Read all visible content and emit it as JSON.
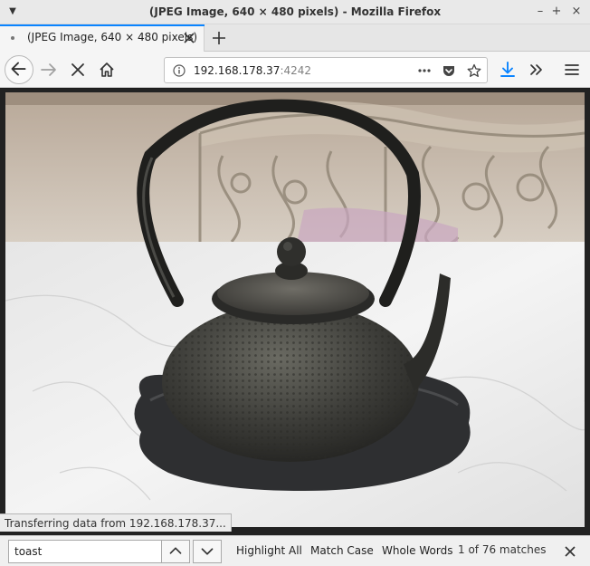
{
  "window": {
    "title": "(JPEG Image, 640 × 480 pixels) - Mozilla Firefox",
    "menu_icon": "chevron-down-icon",
    "minimize_label": "–",
    "maximize_label": "+",
    "close_label": "×"
  },
  "tab": {
    "title": "(JPEG Image, 640 × 480 pixels)",
    "accent_color": "#0a84ff"
  },
  "url": {
    "host": "192.168.178.37",
    "port": ":4242"
  },
  "status": {
    "text": "Transferring data from 192.168.178.37..."
  },
  "findbar": {
    "query": "toast",
    "highlight_all": "Highlight All",
    "match_case": "Match Case",
    "whole_words": "Whole Words",
    "matches": "1 of 76 matches"
  },
  "image": {
    "subject": "cast-iron-teapot-photo"
  },
  "colors": {
    "download_icon": "#0a84ff"
  }
}
